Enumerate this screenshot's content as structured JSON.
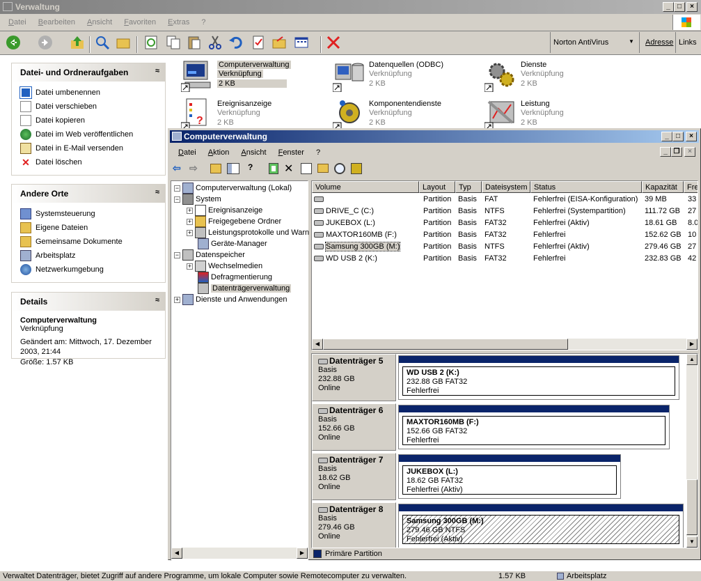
{
  "window": {
    "title": "Verwaltung"
  },
  "menu": [
    "Datei",
    "Bearbeiten",
    "Ansicht",
    "Favoriten",
    "Extras",
    "?"
  ],
  "toolbar": {
    "norton": "Norton AntiVirus",
    "address": "Adresse",
    "links": "Links"
  },
  "sidepanels": {
    "file_tasks": {
      "title": "Datei- und Ordneraufgaben",
      "items": [
        "Datei umbenennen",
        "Datei verschieben",
        "Datei kopieren",
        "Datei im Web veröffentlichen",
        "Datei in E-Mail versenden",
        "Datei löschen"
      ]
    },
    "other_places": {
      "title": "Andere Orte",
      "items": [
        "Systemsteuerung",
        "Eigene Dateien",
        "Gemeinsame Dokumente",
        "Arbeitsplatz",
        "Netzwerkumgebung"
      ]
    },
    "details": {
      "title": "Details",
      "name": "Computerverwaltung",
      "type": "Verknüpfung",
      "changed": "Geändert am: Mittwoch, 17. Dezember 2003, 21:44",
      "size": "Größe: 1.57 KB"
    }
  },
  "files": [
    {
      "name": "Computerverwaltung",
      "type": "Verknüpfung",
      "size": "2 KB"
    },
    {
      "name": "Datenquellen (ODBC)",
      "type": "Verknüpfung",
      "size": "2 KB"
    },
    {
      "name": "Dienste",
      "type": "Verknüpfung",
      "size": "2 KB"
    },
    {
      "name": "Ereignisanzeige",
      "type": "Verknüpfung",
      "size": "2 KB"
    },
    {
      "name": "Komponentendienste",
      "type": "Verknüpfung",
      "size": "2 KB"
    },
    {
      "name": "Leistung",
      "type": "Verknüpfung",
      "size": "2 KB"
    }
  ],
  "cm": {
    "title": "Computerverwaltung",
    "menu": [
      "Datei",
      "Aktion",
      "Ansicht",
      "Fenster",
      "?"
    ],
    "tree": [
      {
        "label": "Computerverwaltung (Lokal)",
        "level": 0,
        "toggle": "−"
      },
      {
        "label": "System",
        "level": 1,
        "toggle": "−"
      },
      {
        "label": "Ereignisanzeige",
        "level": 2,
        "toggle": "+"
      },
      {
        "label": "Freigegebene Ordner",
        "level": 2,
        "toggle": "+"
      },
      {
        "label": "Leistungsprotokolle und Warn",
        "level": 2,
        "toggle": "+"
      },
      {
        "label": "Geräte-Manager",
        "level": 2,
        "toggle": ""
      },
      {
        "label": "Datenspeicher",
        "level": 1,
        "toggle": "−"
      },
      {
        "label": "Wechselmedien",
        "level": 2,
        "toggle": "+"
      },
      {
        "label": "Defragmentierung",
        "level": 2,
        "toggle": ""
      },
      {
        "label": "Datenträgerverwaltung",
        "level": 2,
        "toggle": "",
        "selected": true
      },
      {
        "label": "Dienste und Anwendungen",
        "level": 1,
        "toggle": "+"
      }
    ],
    "columns": [
      "Volume",
      "Layout",
      "Typ",
      "Dateisystem",
      "Status",
      "Kapazität",
      "Fre"
    ],
    "volumes": [
      [
        "",
        "Partition",
        "Basis",
        "FAT",
        "Fehlerfrei (EISA-Konfiguration)",
        "39 MB",
        "33"
      ],
      [
        "DRIVE_C (C:)",
        "Partition",
        "Basis",
        "NTFS",
        "Fehlerfrei (Systempartition)",
        "111.72 GB",
        "27"
      ],
      [
        "JUKEBOX (L:)",
        "Partition",
        "Basis",
        "FAT32",
        "Fehlerfrei (Aktiv)",
        "18.61 GB",
        "8.0"
      ],
      [
        "MAXTOR160MB (F:)",
        "Partition",
        "Basis",
        "FAT32",
        "Fehlerfrei",
        "152.62 GB",
        "10"
      ],
      [
        "Samsung 300GB (M:)",
        "Partition",
        "Basis",
        "NTFS",
        "Fehlerfrei (Aktiv)",
        "279.46 GB",
        "27"
      ],
      [
        "WD USB 2 (K:)",
        "Partition",
        "Basis",
        "FAT32",
        "Fehlerfrei",
        "232.83 GB",
        "42"
      ]
    ],
    "disks": [
      {
        "name": "Datenträger 5",
        "type": "Basis",
        "size": "232.88 GB",
        "state": "Online",
        "part": "WD USB 2  (K:)",
        "pinfo": "232.88 GB FAT32",
        "pstatus": "Fehlerfrei"
      },
      {
        "name": "Datenträger 6",
        "type": "Basis",
        "size": "152.66 GB",
        "state": "Online",
        "part": "MAXTOR160MB  (F:)",
        "pinfo": "152.66 GB FAT32",
        "pstatus": "Fehlerfrei"
      },
      {
        "name": "Datenträger 7",
        "type": "Basis",
        "size": "18.62 GB",
        "state": "Online",
        "part": "JUKEBOX  (L:)",
        "pinfo": "18.62 GB FAT32",
        "pstatus": "Fehlerfrei (Aktiv)"
      },
      {
        "name": "Datenträger 8",
        "type": "Basis",
        "size": "279.46 GB",
        "state": "Online",
        "part": "Samsung 300GB  (M:)",
        "pinfo": "279.46 GB NTFS",
        "pstatus": "Fehlerfrei (Aktiv)"
      }
    ],
    "legend": "Primäre Partition"
  },
  "statusbar": {
    "text": "Verwaltet Datenträger, bietet Zugriff auf andere Programme, um lokale Computer sowie Remotecomputer zu verwalten.",
    "size": "1.57 KB",
    "zone": "Arbeitsplatz"
  }
}
